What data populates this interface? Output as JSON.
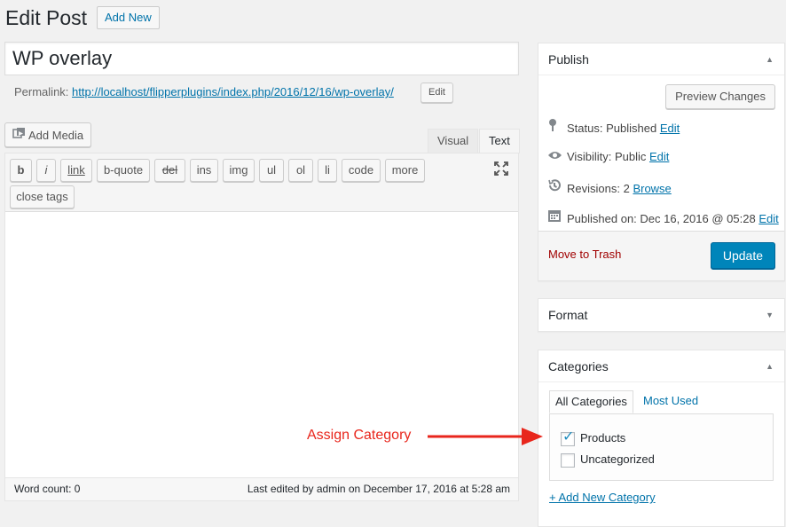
{
  "header": {
    "title": "Edit Post",
    "add_new_label": "Add New"
  },
  "post": {
    "title": "WP overlay",
    "permalink_label": "Permalink:",
    "permalink_url": "http://localhost/flipperplugins/index.php/2016/12/16/wp-overlay/",
    "permalink_edit_label": "Edit"
  },
  "editor": {
    "add_media_label": "Add Media",
    "tabs": {
      "visual": "Visual",
      "text": "Text"
    },
    "quicktags": [
      "b",
      "i",
      "link",
      "b-quote",
      "del",
      "ins",
      "img",
      "ul",
      "ol",
      "li",
      "code",
      "more",
      "close tags"
    ],
    "content": "",
    "word_count": "Word count: 0",
    "last_edited": "Last edited by admin on December 17, 2016 at 5:28 am"
  },
  "publish": {
    "heading": "Publish",
    "preview_label": "Preview Changes",
    "status_label": "Status: Published",
    "visibility_label": "Visibility: Public",
    "revisions_label": "Revisions: 2",
    "published_on_label": "Published on: Dec 16, 2016 @ 05:28",
    "edit_link": "Edit",
    "browse_link": "Browse",
    "trash_label": "Move to Trash",
    "update_label": "Update"
  },
  "format": {
    "heading": "Format"
  },
  "categories": {
    "heading": "Categories",
    "tab_all": "All Categories",
    "tab_most_used": "Most Used",
    "items": [
      {
        "label": "Products",
        "checked": true
      },
      {
        "label": "Uncategorized",
        "checked": false
      }
    ],
    "add_new_label": "+ Add New Category"
  },
  "annotation": {
    "label": "Assign Category",
    "color": "#e8261c"
  },
  "colors": {
    "primary_button": "#0085ba",
    "link": "#0073aa",
    "trash": "#a00000"
  }
}
